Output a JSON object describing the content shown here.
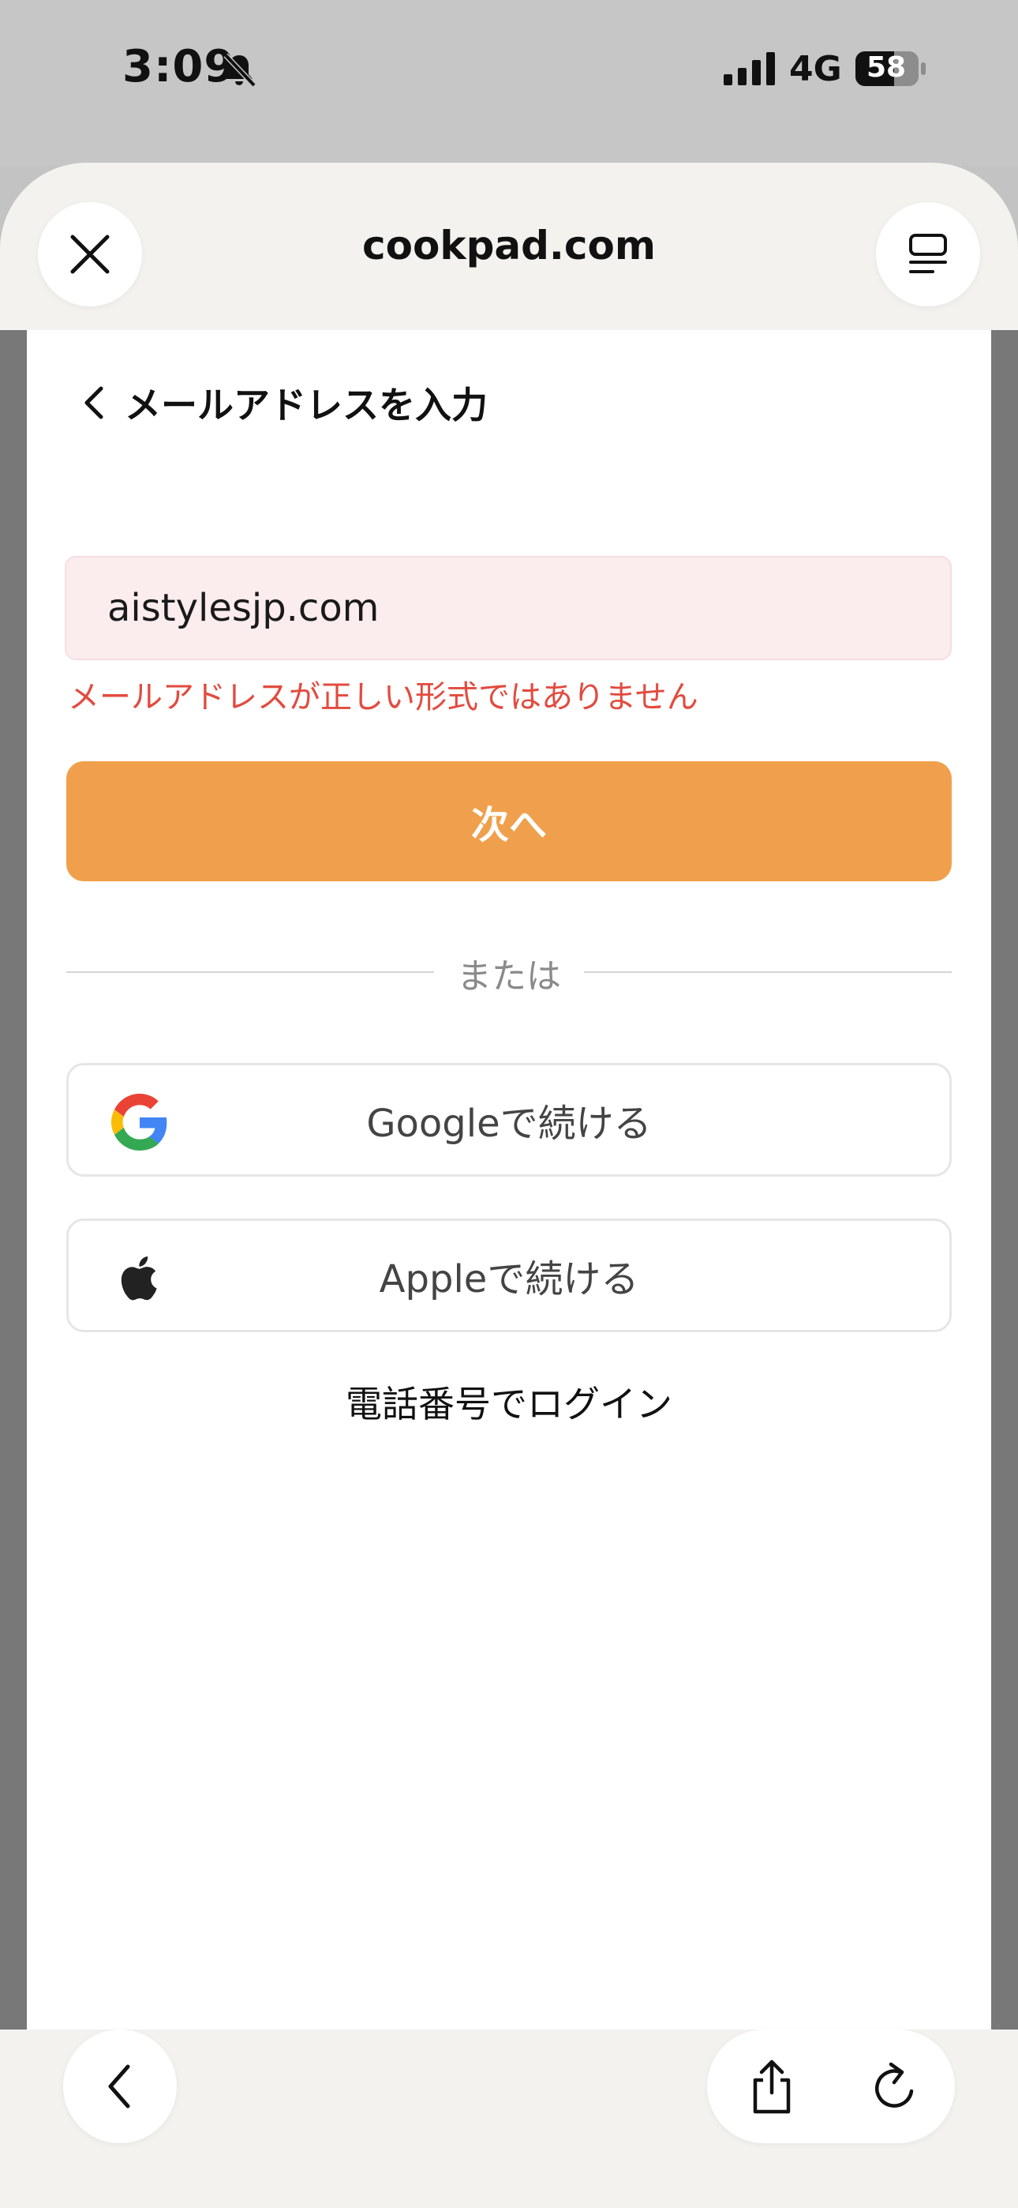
{
  "status_bar": {
    "time": "3:09",
    "network": "4G",
    "battery": "58"
  },
  "browser": {
    "domain": "cookpad.com"
  },
  "page": {
    "back_label": "メールアドレスを入力",
    "email_value": "aistylesjp.com",
    "error_message": "メールアドレスが正しい形式ではありません",
    "next_button": "次へ",
    "divider_text": "または",
    "google_button": "Googleで続ける",
    "apple_button": "Appleで続ける",
    "phone_login": "電話番号でログイン"
  },
  "colors": {
    "primary": "#f0a04c",
    "error": "#e24b3f",
    "input_error_bg": "#fbecee"
  },
  "icons": {
    "close": "close-icon",
    "reader": "reader-mode-icon",
    "back": "chevron-left-icon",
    "google": "google-icon",
    "apple": "apple-icon",
    "share": "share-icon",
    "reload": "reload-icon",
    "bell_off": "bell-slash-icon",
    "signal": "cellular-signal-icon",
    "battery": "battery-icon"
  }
}
